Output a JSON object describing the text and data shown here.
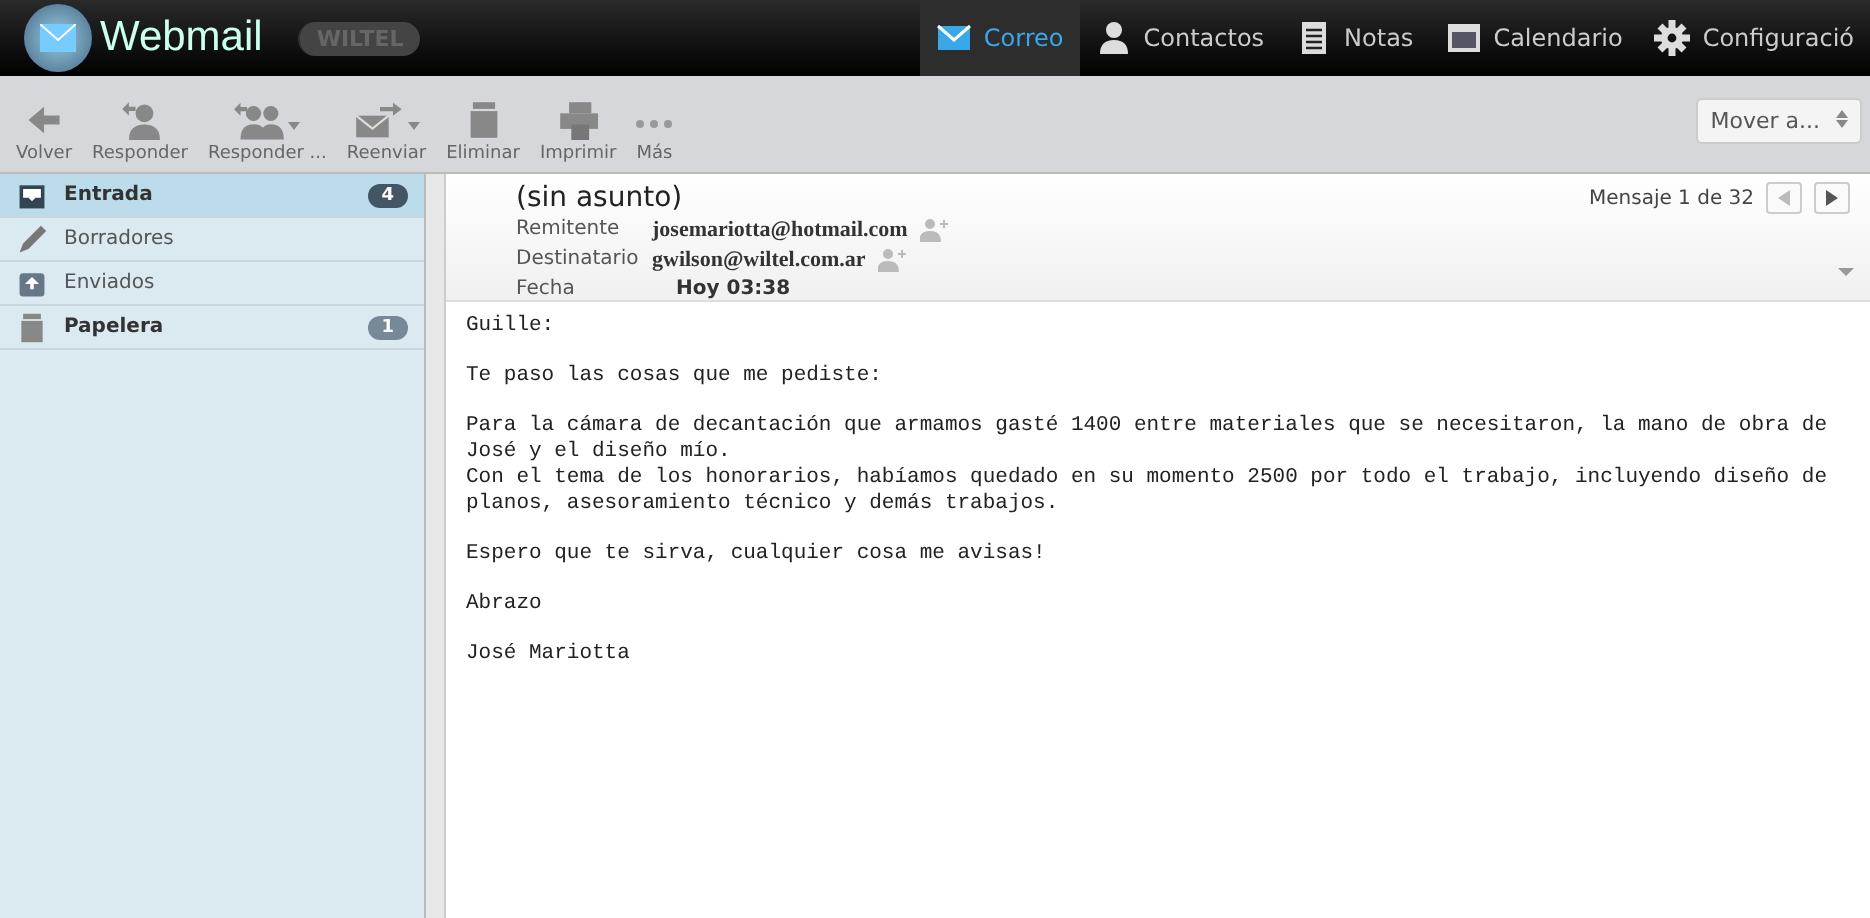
{
  "header": {
    "app_name": "Webmail",
    "brand": "WILTEL",
    "nav": [
      {
        "label": "Correo",
        "selected": true
      },
      {
        "label": "Contactos",
        "selected": false
      },
      {
        "label": "Notas",
        "selected": false
      },
      {
        "label": "Calendario",
        "selected": false
      },
      {
        "label": "Configuració",
        "selected": false
      }
    ]
  },
  "toolbar": {
    "buttons": [
      {
        "label": "Volver",
        "menu": false
      },
      {
        "label": "Responder",
        "menu": false
      },
      {
        "label": "Responder ...",
        "menu": true
      },
      {
        "label": "Reenviar",
        "menu": true
      },
      {
        "label": "Eliminar",
        "menu": false
      },
      {
        "label": "Imprimir",
        "menu": false
      },
      {
        "label": "Más",
        "menu": false
      }
    ],
    "move_select": {
      "value": "Mover a..."
    }
  },
  "folders": [
    {
      "label": "Entrada",
      "badge": "4",
      "selected": true
    },
    {
      "label": "Borradores",
      "selected": false
    },
    {
      "label": "Enviados",
      "selected": false
    },
    {
      "label": "Papelera",
      "badge": "1",
      "selected": false
    }
  ],
  "message": {
    "subject": "(sin asunto)",
    "position": "Mensaje 1 de 32",
    "fields": [
      {
        "label": "Remitente",
        "value": "josemariotta@hotmail.com",
        "kind": "address"
      },
      {
        "label": "Destinatario",
        "value": "gwilson@wiltel.com.ar",
        "kind": "address"
      },
      {
        "label": "Fecha",
        "value": "Hoy 03:38",
        "kind": "date"
      }
    ],
    "body": [
      "Guille:",
      "Te paso las cosas que me pediste:",
      "Para la cámara de decantación que armamos gasté 1400 entre materiales que se necesitaron, la mano de obra de José y el diseño mío.\nCon el tema de los honorarios, habíamos quedado en su momento 2500 por todo el trabajo, incluyendo diseño de planos, asesoramiento técnico y demás trabajos.",
      "Espero que te sirva, cualquier cosa me avisas!",
      "Abrazo",
      "José Mariotta"
    ]
  }
}
